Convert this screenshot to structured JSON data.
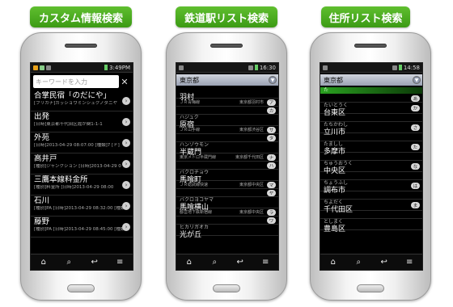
{
  "panels": [
    {
      "banner": "カスタム情報検索",
      "status_time": "3:49PM",
      "search_placeholder": "キーワードを入力",
      "clear_icon": "✕",
      "items": [
        {
          "title": "合掌民宿「のだにや」",
          "sub": "[フリガナ]ガッショウミンシュクノダニヤ"
        },
        {
          "title": "出発",
          "sub": "[日時]東京都千代田区霞が関1-1-1"
        },
        {
          "title": "外苑",
          "sub": "[日時]2013-04-29 08:07:00 [種類]7 [ド]"
        },
        {
          "title": "高井戸",
          "sub": "[種別]ジャンクション [日時]2013-04-29 0"
        },
        {
          "title": "三鷹本線料金所",
          "sub": "[種別]料金所 [日時]2013-04-29 08:00"
        },
        {
          "title": "石川",
          "sub": "[種別]PA [日時]2013-04-29 08:32:00 [種類"
        },
        {
          "title": "藤野",
          "sub": "[種別]PA [日時]2013-04-29 08:45:00 [種類"
        }
      ]
    },
    {
      "banner": "鉄道駅リスト検索",
      "status_time": "16:30",
      "pref": "東京都",
      "stations": [
        {
          "name": "羽村",
          "line": "ＪＲ青梅線",
          "loc": "東京都羽村市",
          "kana": "ハジュク",
          "tag": "ア"
        },
        {
          "name": "原宿",
          "line": "ＪＲ山手線",
          "loc": "東京都渋谷区",
          "kana": "ハンゾウモン",
          "tag": "カ"
        },
        {
          "name": "半蔵門",
          "line": "東京メトロ半蔵門線",
          "loc": "東京都千代田区",
          "kana": "バクロチョウ",
          "tag": "サ"
        },
        {
          "name": "馬喰町",
          "line": "ＪＲ総武線快速",
          "loc": "東京都中央区",
          "kana": "バクロヨコヤマ",
          "tag": "タ"
        },
        {
          "name": "馬喰横山",
          "line": "都営地下鉄新宿線",
          "loc": "東京都中央区",
          "kana": "ヒカリガオカ",
          "tag": "ナ"
        },
        {
          "name": "光が丘",
          "line": "",
          "loc": "",
          "kana": "",
          "tag": "ハ"
        }
      ],
      "index_tags": [
        "ア",
        "カ",
        "サ",
        "タ",
        "ナ",
        "ハ",
        "マ",
        "ヤ",
        "ラ",
        "ワ"
      ]
    },
    {
      "banner": "住所リスト検索",
      "status_time": "14:58",
      "pref": "東京都",
      "highlight": "た",
      "wards": [
        {
          "kana": "たいとうく",
          "name": "台東区",
          "tag": "あ"
        },
        {
          "kana": "たちかわし",
          "name": "立川市",
          "tag": "か"
        },
        {
          "kana": "たましし",
          "name": "多摩市",
          "tag": "さ"
        },
        {
          "kana": "ちゅうおうく",
          "name": "中央区",
          "tag": "た"
        },
        {
          "kana": "ちょうふし",
          "name": "調布市",
          "tag": "な"
        },
        {
          "kana": "ちよだく",
          "name": "千代田区",
          "tag": "は"
        },
        {
          "kana": "としまく",
          "name": "豊島区",
          "tag": "ま"
        }
      ]
    }
  ],
  "nav_icons": [
    "home-icon",
    "search-icon",
    "back-icon",
    "menu-icon"
  ]
}
